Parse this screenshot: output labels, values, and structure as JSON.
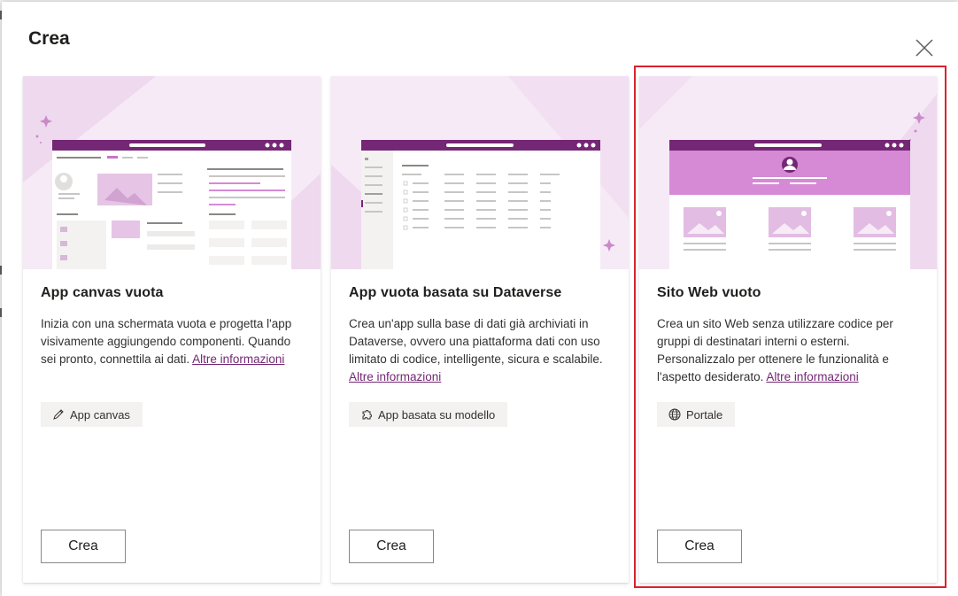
{
  "dialog": {
    "title": "Crea",
    "close_icon": "close-icon"
  },
  "cards": [
    {
      "title": "App canvas vuota",
      "description": "Inizia con una schermata vuota e progetta l'app visivamente aggiungendo componenti. Quando sei pronto, connettila ai dati.",
      "link": "Altre informazioni",
      "chip_icon": "pencil-icon",
      "chip_label": "App canvas",
      "button": "Crea"
    },
    {
      "title": "App vuota basata su Dataverse",
      "description": "Crea un'app sulla base di dati già archiviati in Dataverse, ovvero una piattaforma dati con uso limitato di codice, intelligente, sicura e scalabile.",
      "link": "Altre informazioni",
      "chip_icon": "puzzle-icon",
      "chip_label": "App basata su modello",
      "button": "Crea"
    },
    {
      "title": "Sito Web vuoto",
      "description": "Crea un sito Web senza utilizzare codice per gruppi di destinatari interni o esterni. Personalizzalo per ottenere le funzionalità e l'aspetto desiderato.",
      "link": "Altre informazioni",
      "chip_icon": "globe-icon",
      "chip_label": "Portale",
      "button": "Crea"
    }
  ],
  "colors": {
    "brand": "#742774",
    "highlight": "#d9232e",
    "illustration_bg": "#f6eaf6"
  }
}
